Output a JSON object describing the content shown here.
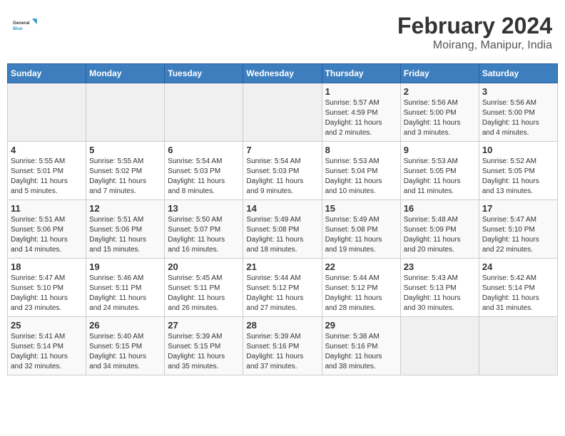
{
  "header": {
    "logo_line1": "General",
    "logo_line2": "Blue",
    "title": "February 2024",
    "subtitle": "Moirang, Manipur, India"
  },
  "weekdays": [
    "Sunday",
    "Monday",
    "Tuesday",
    "Wednesday",
    "Thursday",
    "Friday",
    "Saturday"
  ],
  "weeks": [
    [
      {
        "day": "",
        "info": ""
      },
      {
        "day": "",
        "info": ""
      },
      {
        "day": "",
        "info": ""
      },
      {
        "day": "",
        "info": ""
      },
      {
        "day": "1",
        "info": "Sunrise: 5:57 AM\nSunset: 4:59 PM\nDaylight: 11 hours\nand 2 minutes."
      },
      {
        "day": "2",
        "info": "Sunrise: 5:56 AM\nSunset: 5:00 PM\nDaylight: 11 hours\nand 3 minutes."
      },
      {
        "day": "3",
        "info": "Sunrise: 5:56 AM\nSunset: 5:00 PM\nDaylight: 11 hours\nand 4 minutes."
      }
    ],
    [
      {
        "day": "4",
        "info": "Sunrise: 5:55 AM\nSunset: 5:01 PM\nDaylight: 11 hours\nand 5 minutes."
      },
      {
        "day": "5",
        "info": "Sunrise: 5:55 AM\nSunset: 5:02 PM\nDaylight: 11 hours\nand 7 minutes."
      },
      {
        "day": "6",
        "info": "Sunrise: 5:54 AM\nSunset: 5:03 PM\nDaylight: 11 hours\nand 8 minutes."
      },
      {
        "day": "7",
        "info": "Sunrise: 5:54 AM\nSunset: 5:03 PM\nDaylight: 11 hours\nand 9 minutes."
      },
      {
        "day": "8",
        "info": "Sunrise: 5:53 AM\nSunset: 5:04 PM\nDaylight: 11 hours\nand 10 minutes."
      },
      {
        "day": "9",
        "info": "Sunrise: 5:53 AM\nSunset: 5:05 PM\nDaylight: 11 hours\nand 11 minutes."
      },
      {
        "day": "10",
        "info": "Sunrise: 5:52 AM\nSunset: 5:05 PM\nDaylight: 11 hours\nand 13 minutes."
      }
    ],
    [
      {
        "day": "11",
        "info": "Sunrise: 5:51 AM\nSunset: 5:06 PM\nDaylight: 11 hours\nand 14 minutes."
      },
      {
        "day": "12",
        "info": "Sunrise: 5:51 AM\nSunset: 5:06 PM\nDaylight: 11 hours\nand 15 minutes."
      },
      {
        "day": "13",
        "info": "Sunrise: 5:50 AM\nSunset: 5:07 PM\nDaylight: 11 hours\nand 16 minutes."
      },
      {
        "day": "14",
        "info": "Sunrise: 5:49 AM\nSunset: 5:08 PM\nDaylight: 11 hours\nand 18 minutes."
      },
      {
        "day": "15",
        "info": "Sunrise: 5:49 AM\nSunset: 5:08 PM\nDaylight: 11 hours\nand 19 minutes."
      },
      {
        "day": "16",
        "info": "Sunrise: 5:48 AM\nSunset: 5:09 PM\nDaylight: 11 hours\nand 20 minutes."
      },
      {
        "day": "17",
        "info": "Sunrise: 5:47 AM\nSunset: 5:10 PM\nDaylight: 11 hours\nand 22 minutes."
      }
    ],
    [
      {
        "day": "18",
        "info": "Sunrise: 5:47 AM\nSunset: 5:10 PM\nDaylight: 11 hours\nand 23 minutes."
      },
      {
        "day": "19",
        "info": "Sunrise: 5:46 AM\nSunset: 5:11 PM\nDaylight: 11 hours\nand 24 minutes."
      },
      {
        "day": "20",
        "info": "Sunrise: 5:45 AM\nSunset: 5:11 PM\nDaylight: 11 hours\nand 26 minutes."
      },
      {
        "day": "21",
        "info": "Sunrise: 5:44 AM\nSunset: 5:12 PM\nDaylight: 11 hours\nand 27 minutes."
      },
      {
        "day": "22",
        "info": "Sunrise: 5:44 AM\nSunset: 5:12 PM\nDaylight: 11 hours\nand 28 minutes."
      },
      {
        "day": "23",
        "info": "Sunrise: 5:43 AM\nSunset: 5:13 PM\nDaylight: 11 hours\nand 30 minutes."
      },
      {
        "day": "24",
        "info": "Sunrise: 5:42 AM\nSunset: 5:14 PM\nDaylight: 11 hours\nand 31 minutes."
      }
    ],
    [
      {
        "day": "25",
        "info": "Sunrise: 5:41 AM\nSunset: 5:14 PM\nDaylight: 11 hours\nand 32 minutes."
      },
      {
        "day": "26",
        "info": "Sunrise: 5:40 AM\nSunset: 5:15 PM\nDaylight: 11 hours\nand 34 minutes."
      },
      {
        "day": "27",
        "info": "Sunrise: 5:39 AM\nSunset: 5:15 PM\nDaylight: 11 hours\nand 35 minutes."
      },
      {
        "day": "28",
        "info": "Sunrise: 5:39 AM\nSunset: 5:16 PM\nDaylight: 11 hours\nand 37 minutes."
      },
      {
        "day": "29",
        "info": "Sunrise: 5:38 AM\nSunset: 5:16 PM\nDaylight: 11 hours\nand 38 minutes."
      },
      {
        "day": "",
        "info": ""
      },
      {
        "day": "",
        "info": ""
      }
    ]
  ]
}
